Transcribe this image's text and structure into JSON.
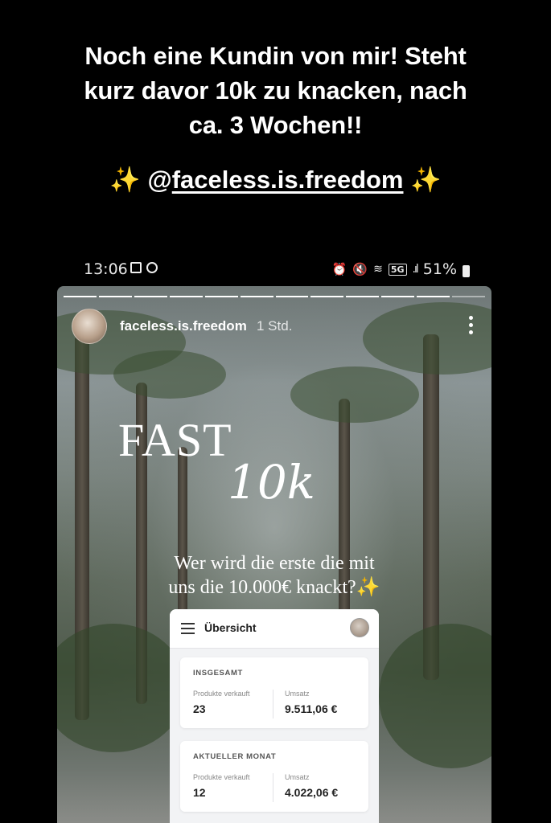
{
  "caption": {
    "line1": "Noch eine Kundin von mir! Steht",
    "line2": "kurz davor 10k zu knacken, nach",
    "line3": "ca. 3 Wochen!!",
    "sparkle_left": "✨",
    "at": "@",
    "handle": "faceless.is.freedom",
    "sparkle_right": "✨"
  },
  "statusbar": {
    "time": "13:06",
    "network": "5G",
    "battery": "51%",
    "icons": [
      "gallery-icon",
      "whatsapp-icon",
      "alarm-icon",
      "mute-icon",
      "wifi-icon",
      "signal-icon",
      "battery-icon"
    ]
  },
  "story": {
    "progress_segments": 12,
    "progress_done": 11,
    "username": "faceless.is.freedom",
    "time_ago": "1 Std.",
    "headline": "FAST",
    "headline_script": "10k",
    "tagline_line1": "Wer wird die erste die mit",
    "tagline_line2": "uns die 10.000€ knackt?✨"
  },
  "dashboard": {
    "title": "Übersicht",
    "total": {
      "heading": "INSGESAMT",
      "products_label": "Produkte verkauft",
      "products_value": "23",
      "revenue_label": "Umsatz",
      "revenue_value": "9.511,06 €"
    },
    "month": {
      "heading": "AKTUELLER MONAT",
      "products_label": "Produkte verkauft",
      "products_value": "12",
      "revenue_label": "Umsatz",
      "revenue_value": "4.022,06 €"
    }
  }
}
